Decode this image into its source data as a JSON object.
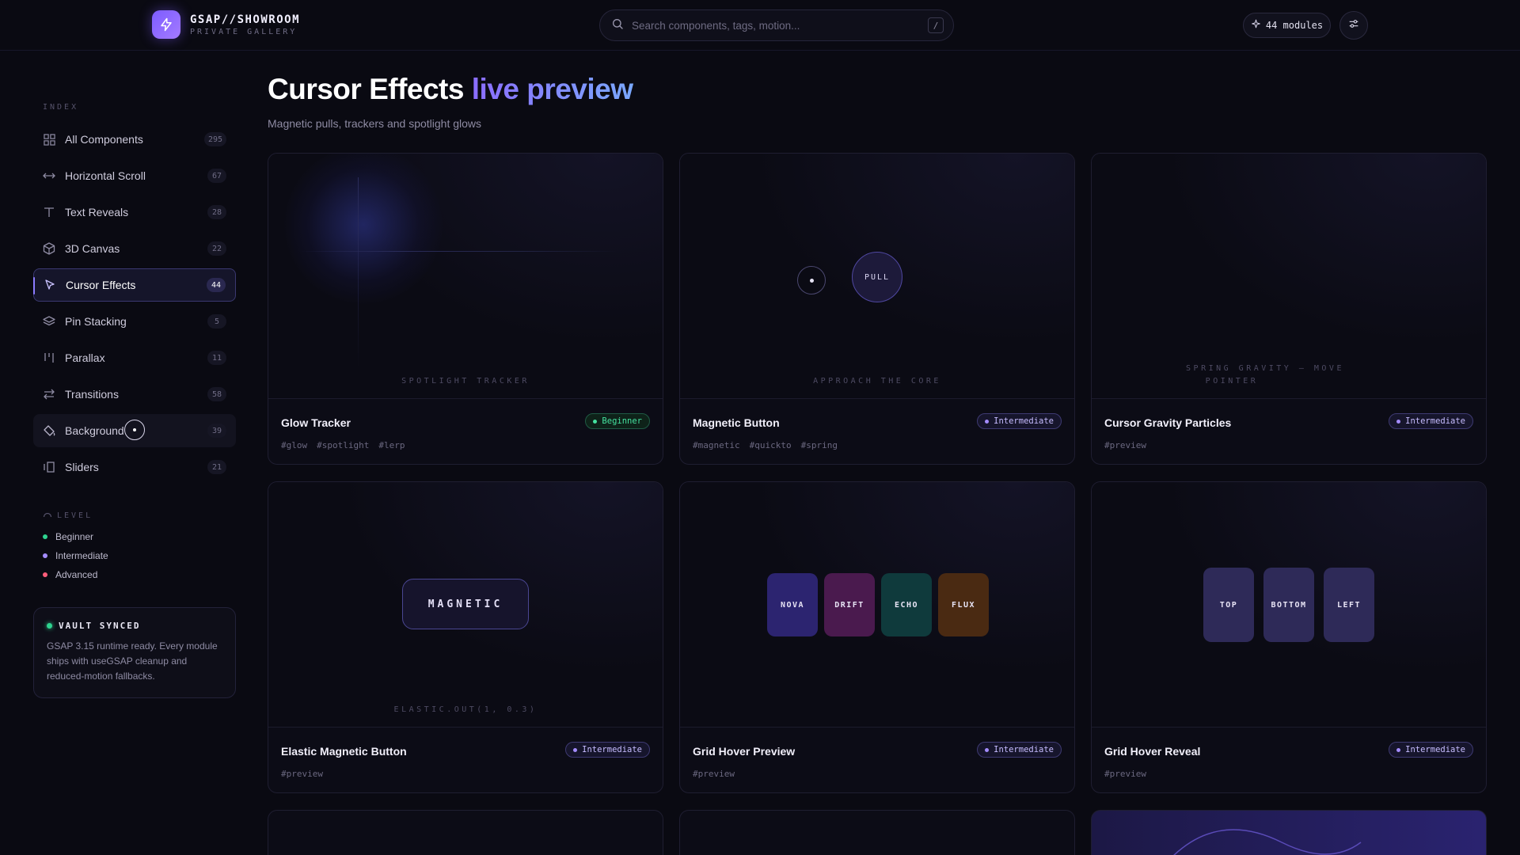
{
  "brand": {
    "title": "GSAP//SHOWROOM",
    "subtitle": "PRIVATE GALLERY"
  },
  "search": {
    "placeholder": "Search components, tags, motion...",
    "shortcut": "/"
  },
  "header": {
    "modules_label": "44 modules"
  },
  "sidebar": {
    "index_label": "INDEX",
    "items": [
      {
        "label": "All Components",
        "count": "295",
        "icon": "grid-icon"
      },
      {
        "label": "Horizontal Scroll",
        "count": "67",
        "icon": "horizontal-arrows-icon"
      },
      {
        "label": "Text Reveals",
        "count": "28",
        "icon": "text-icon"
      },
      {
        "label": "3D Canvas",
        "count": "22",
        "icon": "cube-icon"
      },
      {
        "label": "Cursor Effects",
        "count": "44",
        "icon": "cursor-icon",
        "active": true
      },
      {
        "label": "Pin Stacking",
        "count": "5",
        "icon": "layers-icon"
      },
      {
        "label": "Parallax",
        "count": "11",
        "icon": "parallax-bars-icon"
      },
      {
        "label": "Transitions",
        "count": "58",
        "icon": "swap-arrows-icon"
      },
      {
        "label": "Background",
        "count": "39",
        "icon": "paint-bucket-icon"
      },
      {
        "label": "Sliders",
        "count": "21",
        "icon": "slider-panels-icon"
      }
    ],
    "level_label": "LEVEL",
    "levels": [
      {
        "label": "Beginner",
        "color": "#2ed38f"
      },
      {
        "label": "Intermediate",
        "color": "#a48cff"
      },
      {
        "label": "Advanced",
        "color": "#ff5d7a"
      }
    ],
    "vault": {
      "title": "VAULT SYNCED",
      "text": "GSAP 3.15 runtime ready. Every module ships with useGSAP cleanup and reduced-motion fallbacks."
    }
  },
  "main": {
    "title": "Cursor Effects",
    "title_accent": "live preview",
    "subtitle": "Magnetic pulls, trackers and spotlight glows",
    "cards": [
      {
        "name": "Glow Tracker",
        "level": "Beginner",
        "tags": [
          "#glow",
          "#spotlight",
          "#lerp"
        ],
        "caption": "SPOTLIGHT TRACKER"
      },
      {
        "name": "Magnetic Button",
        "level": "Intermediate",
        "tags": [
          "#magnetic",
          "#quickto",
          "#spring"
        ],
        "caption": "APPROACH THE CORE",
        "button_label": "PULL"
      },
      {
        "name": "Cursor Gravity Particles",
        "level": "Intermediate",
        "tags": [
          "#preview"
        ],
        "caption_line1": "SPRING GRAVITY — MOVE",
        "caption_line2": "POINTER"
      },
      {
        "name": "Elastic Magnetic Button",
        "level": "Intermediate",
        "tags": [
          "#preview"
        ],
        "caption": "ELASTIC.OUT(1, 0.3)",
        "button_label": "MAGNETIC"
      },
      {
        "name": "Grid Hover Preview",
        "level": "Intermediate",
        "tags": [
          "#preview"
        ],
        "tiles": [
          "NOVA",
          "DRIFT",
          "ECHO",
          "FLUX"
        ]
      },
      {
        "name": "Grid Hover Reveal",
        "level": "Intermediate",
        "tags": [
          "#preview"
        ],
        "tiles": [
          "TOP",
          "BOTTOM",
          "LEFT"
        ]
      }
    ]
  },
  "colors": {
    "accent": "#8b6dff",
    "beginner": "#45e3a0",
    "intermediate": "#a48cff",
    "advanced": "#ff5d7a",
    "tile_nova": "#2c2470",
    "tile_drift": "#4a1a4e",
    "tile_echo": "#0f3a3c",
    "tile_flux": "#4a2a12"
  }
}
